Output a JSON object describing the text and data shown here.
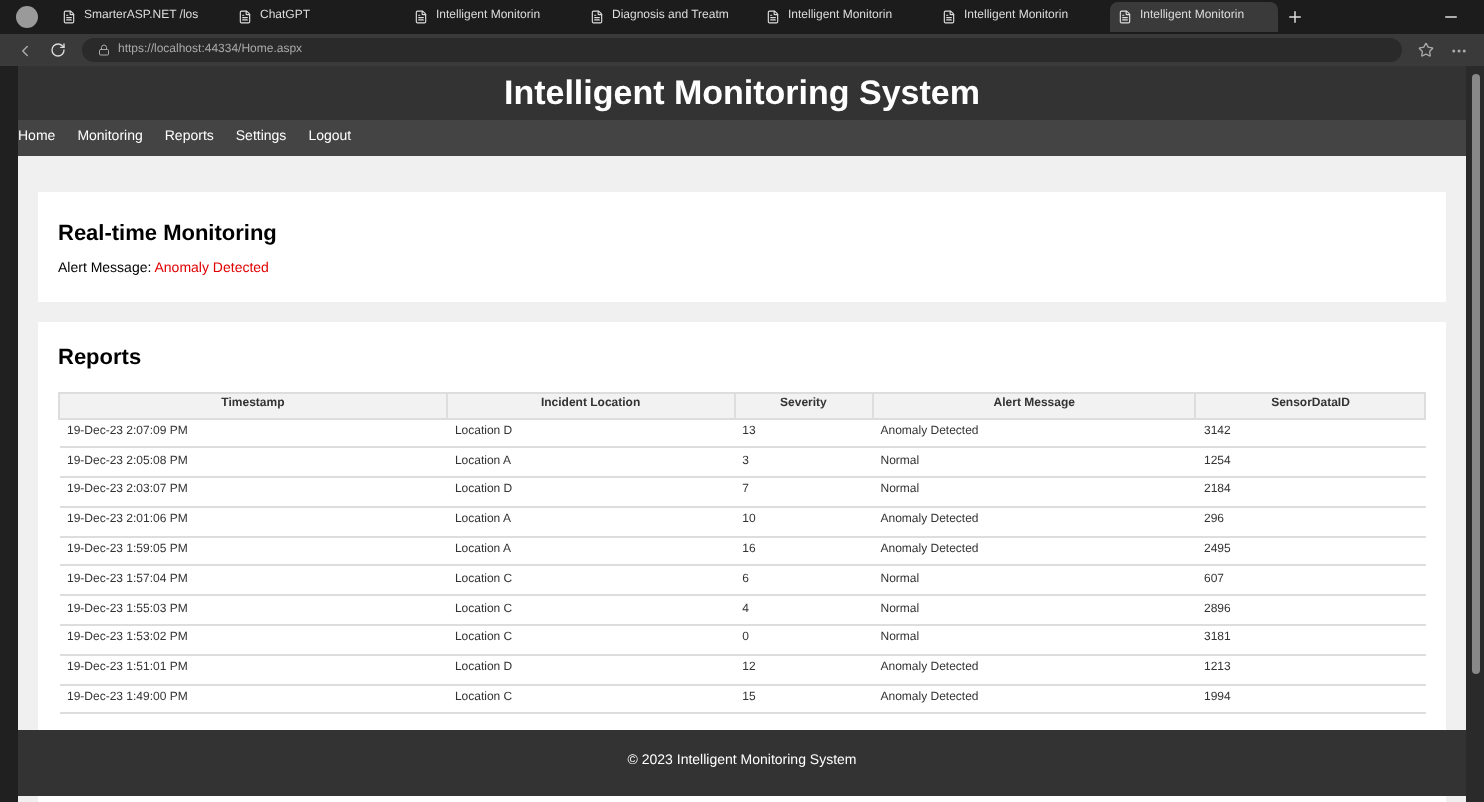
{
  "browser": {
    "tabs": [
      {
        "label": "SmarterASP.NET /los",
        "selected": false
      },
      {
        "label": "ChatGPT",
        "selected": false
      },
      {
        "label": "Intelligent Monitorin",
        "selected": false
      },
      {
        "label": "Diagnosis and Treatm",
        "selected": false
      },
      {
        "label": "Intelligent Monitorin",
        "selected": false
      },
      {
        "label": "Intelligent Monitorin",
        "selected": false
      },
      {
        "label": "Intelligent Monitorin",
        "selected": true
      }
    ],
    "url": "https://localhost:44334/Home.aspx"
  },
  "header": {
    "title": "Intelligent Monitoring System"
  },
  "nav": [
    "Home",
    "Monitoring",
    "Reports",
    "Settings",
    "Logout"
  ],
  "realtime": {
    "title": "Real-time Monitoring",
    "label": "Alert Message:",
    "value": "Anomaly Detected"
  },
  "reports": {
    "title": "Reports",
    "columns": [
      "Timestamp",
      "Incident Location",
      "Severity",
      "Alert Message",
      "SensorDataID"
    ],
    "rows": [
      [
        "19-Dec-23 2:07:09 PM",
        "Location D",
        "13",
        "Anomaly Detected",
        "3142"
      ],
      [
        "19-Dec-23 2:05:08 PM",
        "Location A",
        "3",
        "Normal",
        "1254"
      ],
      [
        "19-Dec-23 2:03:07 PM",
        "Location D",
        "7",
        "Normal",
        "2184"
      ],
      [
        "19-Dec-23 2:01:06 PM",
        "Location A",
        "10",
        "Anomaly Detected",
        "296"
      ],
      [
        "19-Dec-23 1:59:05 PM",
        "Location A",
        "16",
        "Anomaly Detected",
        "2495"
      ],
      [
        "19-Dec-23 1:57:04 PM",
        "Location C",
        "6",
        "Normal",
        "607"
      ],
      [
        "19-Dec-23 1:55:03 PM",
        "Location C",
        "4",
        "Normal",
        "2896"
      ],
      [
        "19-Dec-23 1:53:02 PM",
        "Location C",
        "0",
        "Normal",
        "3181"
      ],
      [
        "19-Dec-23 1:51:01 PM",
        "Location D",
        "12",
        "Anomaly Detected",
        "1213"
      ],
      [
        "19-Dec-23 1:49:00 PM",
        "Location C",
        "15",
        "Anomaly Detected",
        "1994"
      ]
    ]
  },
  "footer": "© 2023 Intelligent Monitoring System"
}
